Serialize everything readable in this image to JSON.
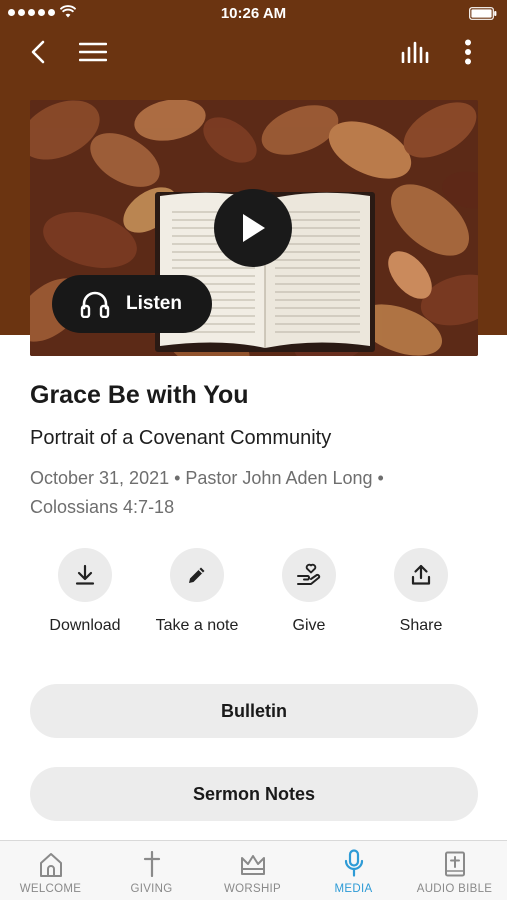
{
  "status_bar": {
    "time": "10:26 AM"
  },
  "colors": {
    "header_brown": "#6b3411",
    "accent_blue": "#2e9bd6",
    "button_gray": "#ececec"
  },
  "nav": {
    "back_icon": "chevron-left-icon",
    "menu_icon": "hamburger-menu-icon",
    "audio_icon": "audio-bars-icon",
    "more_icon": "more-vertical-icon"
  },
  "hero": {
    "image": "open-bible-on-autumn-leaves",
    "play_icon": "play-icon",
    "listen_label": "Listen"
  },
  "sermon": {
    "title": "Grace Be with You",
    "series": "Portrait of a Covenant Community",
    "meta": "October 31, 2021 • Pastor John Aden Long • Colossians 4:7-18"
  },
  "actions": [
    {
      "label": "Download",
      "icon": "download-icon"
    },
    {
      "label": "Take a note",
      "icon": "pencil-icon"
    },
    {
      "label": "Give",
      "icon": "give-hand-heart-icon"
    },
    {
      "label": "Share",
      "icon": "share-icon"
    }
  ],
  "buttons": {
    "bulletin": "Bulletin",
    "sermon_notes": "Sermon Notes"
  },
  "tabs": [
    {
      "label": "WELCOME",
      "icon": "church-icon",
      "active": false
    },
    {
      "label": "GIVING",
      "icon": "cross-icon",
      "active": false
    },
    {
      "label": "WORSHIP",
      "icon": "crown-icon",
      "active": false
    },
    {
      "label": "MEDIA",
      "icon": "microphone-icon",
      "active": true
    },
    {
      "label": "AUDIO BIBLE",
      "icon": "bible-icon",
      "active": false
    }
  ]
}
